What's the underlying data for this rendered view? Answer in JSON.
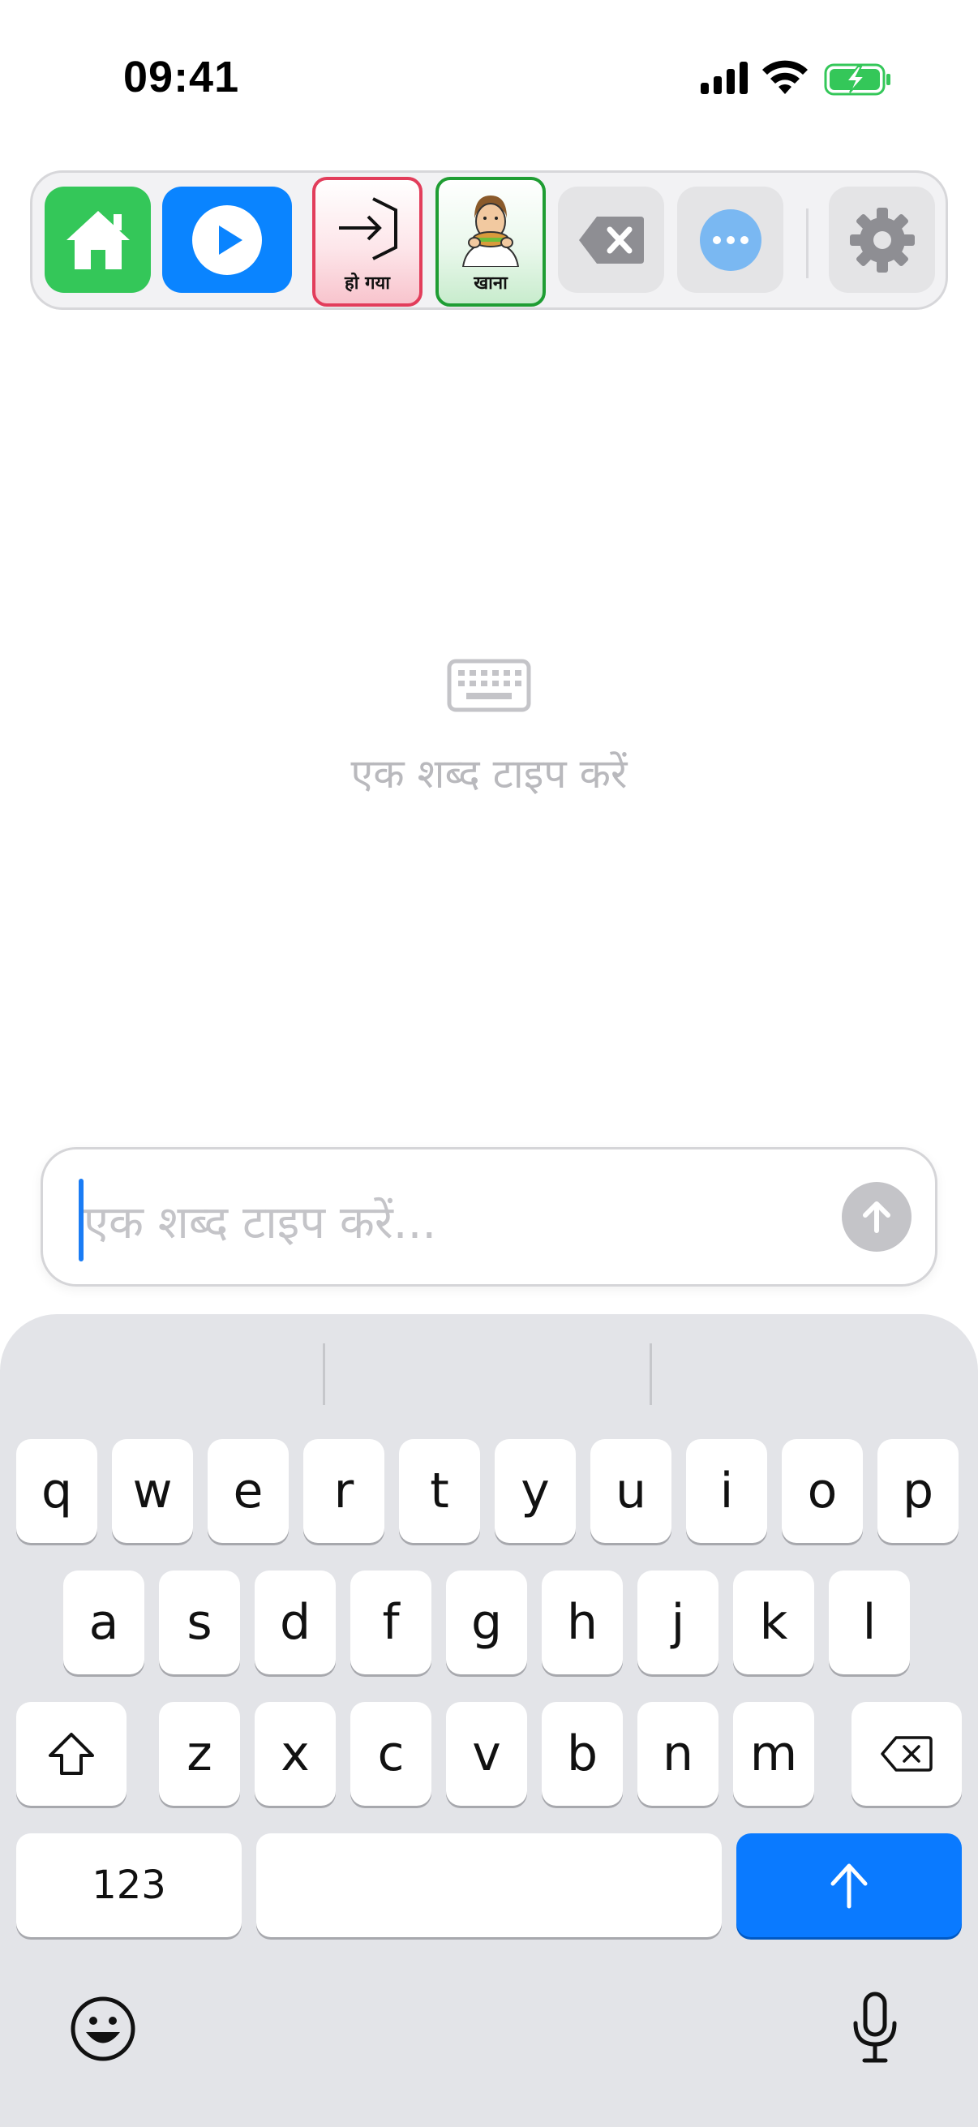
{
  "status_bar": {
    "time": "09:41",
    "signal_icon": "cellular-signal-icon",
    "wifi_icon": "wifi-icon",
    "battery_icon": "battery-charging-icon"
  },
  "toolbar": {
    "home_icon": "home-icon",
    "play_icon": "play-icon",
    "done_label": "हो गया",
    "eat_label": "खाना",
    "delete_icon": "delete-icon",
    "more_icon": "ellipsis-icon",
    "settings_icon": "gear-icon",
    "colors": {
      "home": "#34c759",
      "play": "#0a84ff",
      "done_border": "#e23d5b",
      "eat_border": "#1f9d33"
    }
  },
  "empty_state": {
    "icon": "keyboard-icon",
    "text": "एक शब्द टाइप करें"
  },
  "input": {
    "placeholder": "एक शब्द टाइप करें...",
    "value": "",
    "send_icon": "arrow-up-icon"
  },
  "keyboard": {
    "row1": [
      "q",
      "w",
      "e",
      "r",
      "t",
      "y",
      "u",
      "i",
      "o",
      "p"
    ],
    "row2": [
      "a",
      "s",
      "d",
      "f",
      "g",
      "h",
      "j",
      "k",
      "l"
    ],
    "row3": [
      "z",
      "x",
      "c",
      "v",
      "b",
      "n",
      "m"
    ],
    "numbers_label": "123",
    "shift_icon": "shift-icon",
    "backspace_icon": "backspace-icon",
    "return_icon": "arrow-up-icon",
    "emoji_icon": "emoji-icon",
    "mic_icon": "microphone-icon",
    "accent": "#0a7aff"
  }
}
